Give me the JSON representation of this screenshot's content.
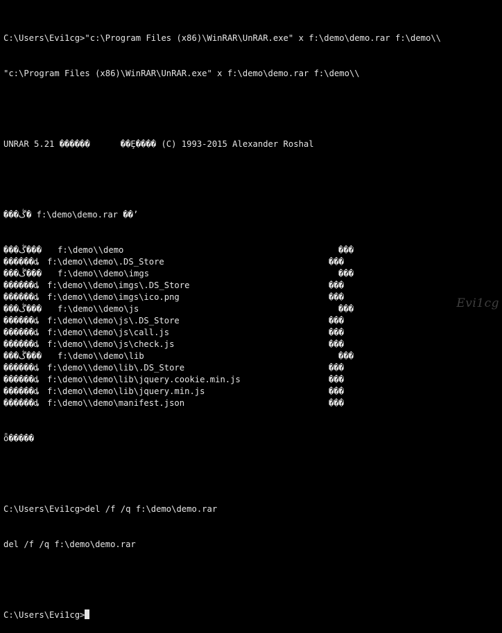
{
  "console": {
    "cmd1": "C:\\Users\\Evi1cg>\"c:\\Program Files (x86)\\WinRAR\\UnRAR.exe\" x f:\\demo\\demo.rar f:\\demo\\\\",
    "echo1": "\"c:\\Program Files (x86)\\WinRAR\\UnRAR.exe\" x f:\\demo\\demo.rar f:\\demo\\\\",
    "banner": "UNRAR 5.21 ������      ��Ȩ���� (C) 1993-2015 Alexander Roshal",
    "archive_line": "���ڴ� f:\\demo\\demo.rar ��ʼ",
    "entries": [
      {
        "status": "���ڴ���",
        "path": "f:\\demo\\\\demo",
        "result": "���",
        "kind": "dir"
      },
      {
        "status": "������ȡ",
        "path": "f:\\demo\\\\demo\\.DS_Store",
        "result": "���",
        "kind": "file"
      },
      {
        "status": "���ڴ���",
        "path": "f:\\demo\\\\demo\\imgs",
        "result": "���",
        "kind": "dir"
      },
      {
        "status": "������ȡ",
        "path": "f:\\demo\\\\demo\\imgs\\.DS_Store",
        "result": "���",
        "kind": "file"
      },
      {
        "status": "������ȡ",
        "path": "f:\\demo\\\\demo\\imgs\\ico.png",
        "result": "���",
        "kind": "file"
      },
      {
        "status": "���ڴ���",
        "path": "f:\\demo\\\\demo\\js",
        "result": "���",
        "kind": "dir"
      },
      {
        "status": "������ȡ",
        "path": "f:\\demo\\\\demo\\js\\.DS_Store",
        "result": "���",
        "kind": "file"
      },
      {
        "status": "������ȡ",
        "path": "f:\\demo\\\\demo\\js\\call.js",
        "result": "���",
        "kind": "file"
      },
      {
        "status": "������ȡ",
        "path": "f:\\demo\\\\demo\\js\\check.js",
        "result": "���",
        "kind": "file"
      },
      {
        "status": "���ڴ���",
        "path": "f:\\demo\\\\demo\\lib",
        "result": "���",
        "kind": "dir"
      },
      {
        "status": "������ȡ",
        "path": "f:\\demo\\\\demo\\lib\\.DS_Store",
        "result": "���",
        "kind": "file"
      },
      {
        "status": "������ȡ",
        "path": "f:\\demo\\\\demo\\lib\\jquery.cookie.min.js",
        "result": "���",
        "kind": "file"
      },
      {
        "status": "������ȡ",
        "path": "f:\\demo\\\\demo\\lib\\jquery.min.js",
        "result": "���",
        "kind": "file"
      },
      {
        "status": "������ȡ",
        "path": "f:\\demo\\\\demo\\manifest.json",
        "result": "���",
        "kind": "file"
      }
    ],
    "all_ok": "ȫ�����",
    "cmd2": "C:\\Users\\Evi1cg>del /f /q f:\\demo\\demo.rar",
    "echo2": "del /f /q f:\\demo\\demo.rar",
    "prompt": "C:\\Users\\Evi1cg>"
  },
  "watermark": "Evi1cg",
  "colors": {
    "background": "#000000",
    "text": "#e6e6e6",
    "watermark": "#4a4a4a"
  }
}
